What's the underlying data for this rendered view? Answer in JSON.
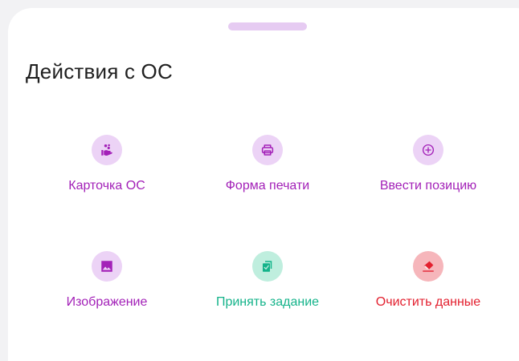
{
  "sheet": {
    "title": "Действия с ОС"
  },
  "actions": [
    {
      "label": "Карточка ОС",
      "icon": "hand-coins-icon",
      "color": "#a321b8"
    },
    {
      "label": "Форма печати",
      "icon": "printer-icon",
      "color": "#a321b8"
    },
    {
      "label": "Ввести позицию",
      "icon": "plus-circle-icon",
      "color": "#a321b8"
    },
    {
      "label": "Изображение",
      "icon": "image-icon",
      "color": "#a321b8"
    },
    {
      "label": "Принять задание",
      "icon": "accept-task-icon",
      "color": "#14b38a"
    },
    {
      "label": "Очистить данные",
      "icon": "eraser-icon",
      "color": "#e3202f"
    }
  ]
}
